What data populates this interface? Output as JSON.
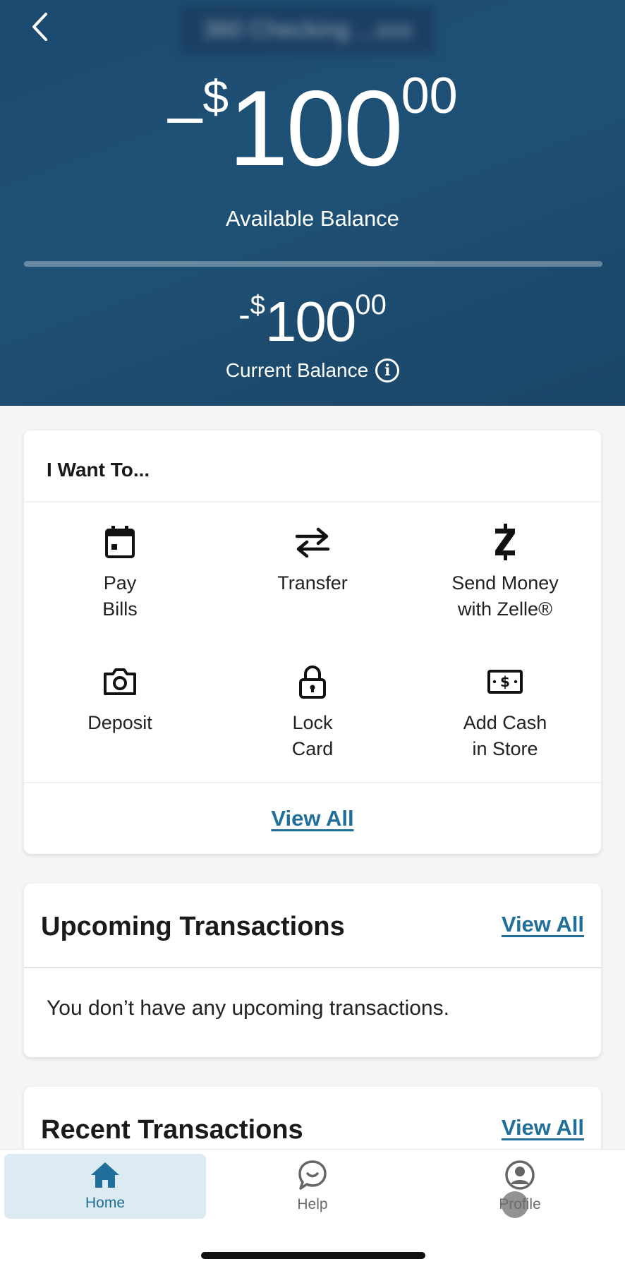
{
  "header": {
    "account_name": "360 Checking ...xxx",
    "available_balance": {
      "sign": "–",
      "currency": "$",
      "dollars": "100",
      "cents": "00"
    },
    "available_label": "Available Balance",
    "current_balance": {
      "sign": "-",
      "currency": "$",
      "dollars": "100",
      "cents": "00"
    },
    "current_label": "Current Balance",
    "background_color": "#1f5176"
  },
  "i_want_to": {
    "title": "I Want To...",
    "actions": [
      {
        "line1": "Pay",
        "line2": "Bills",
        "icon": "calendar-icon"
      },
      {
        "line1": "Transfer",
        "line2": "",
        "icon": "transfer-arrows-icon"
      },
      {
        "line1": "Send Money",
        "line2": "with Zelle®",
        "icon": "zelle-icon"
      },
      {
        "line1": "Deposit",
        "line2": "",
        "icon": "camera-icon"
      },
      {
        "line1": "Lock",
        "line2": "Card",
        "icon": "lock-icon"
      },
      {
        "line1": "Add Cash",
        "line2": "in Store",
        "icon": "cash-icon"
      }
    ],
    "view_all": "View All"
  },
  "upcoming": {
    "title": "Upcoming Transactions",
    "view_all": "View All",
    "empty_message": "You don’t have any upcoming transactions."
  },
  "recent": {
    "title": "Recent Transactions",
    "view_all": "View All"
  },
  "nav": {
    "home": "Home",
    "help": "Help",
    "profile": "Profile",
    "accent_color": "#1f6f9a"
  }
}
